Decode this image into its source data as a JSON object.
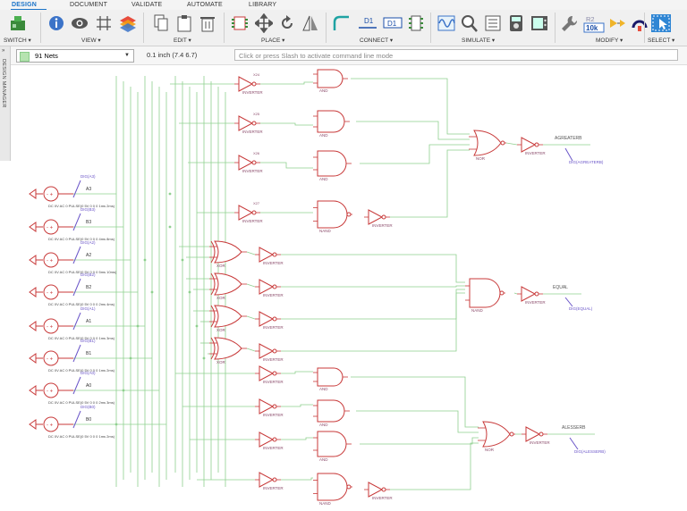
{
  "tabs": [
    {
      "label": "DESIGN",
      "active": true
    },
    {
      "label": "DOCUMENT",
      "active": false
    },
    {
      "label": "VALIDATE",
      "active": false
    },
    {
      "label": "AUTOMATE",
      "active": false
    },
    {
      "label": "LIBRARY",
      "active": false
    }
  ],
  "ribbon": {
    "switch_label": "SWITCH ▾",
    "view_label": "VIEW ▾",
    "edit_label": "EDIT ▾",
    "place_label": "PLACE ▾",
    "connect_label": "CONNECT ▾",
    "simulate_label": "SIMULATE ▾",
    "modify_label": "MODIFY ▾",
    "select_label": "SELECT ▾",
    "icon_d1a": "D1",
    "icon_d1b": "D1",
    "icon_r2": "R2",
    "icon_10k": "10k"
  },
  "cmdbar": {
    "net_select": "91 Nets",
    "grid_info": "0.1 inch (7.4 6.7)",
    "cmd_placeholder": "Click or press Slash to activate command line mode"
  },
  "sidebar": {
    "design_manager": "DESIGN MANAGER"
  },
  "schematic": {
    "wire_color": "#8fd08f",
    "part_color": "#c83a3a",
    "label_color": "#6a55c8",
    "sources": [
      {
        "name": "A3",
        "dig": "DIG(A3)",
        "param": "DC 0V AC 0 PULSE(0 5V 0 0 0 1ms 2ms)"
      },
      {
        "name": "B3",
        "dig": "DIG(B3)",
        "param": "DC 0V AC 0 PULSE(0 5V 0 0 0 4ms 8ms)"
      },
      {
        "name": "A2",
        "dig": "DIG(A2)",
        "param": "DC 0V AC 0 PULSE(0 5V 0 0 0 5ms 10ms)"
      },
      {
        "name": "B2",
        "dig": "DIG(B2)",
        "param": "DC 0V AC 0 PULSE(0 5V 0 0 0 2ms 4ms)"
      },
      {
        "name": "A1",
        "dig": "DIG(A1)",
        "param": "DC 0V AC 0 PULSE(0 5V 0 0 0 1ms 3ms)"
      },
      {
        "name": "B1",
        "dig": "DIG(B1)",
        "param": "DC 0V AC 0 PULSE(0 5V 0 0 0 1ms 2ms)"
      },
      {
        "name": "A0",
        "dig": "DIG(A0)",
        "param": "DC 0V AC 0 PULSE(0 5V 0 0 0 2ms 3ms)"
      },
      {
        "name": "B0",
        "dig": "DIG(B0)",
        "param": "DC 0V AC 0 PULSE(0 5V 0 0 0 1ms 2ms)"
      }
    ],
    "inverter_label": "INVERTER",
    "and_label": "AND",
    "nand_label": "NAND",
    "xor_label": "XOR",
    "nor_label": "NOR",
    "outputs": [
      {
        "net": "AGREATERB",
        "dig": "DIG(AGREATERB)"
      },
      {
        "net": "EQUAL",
        "dig": "DIG(EQUAL)"
      },
      {
        "net": "ALESSERB",
        "dig": "DIG(ALESSERB)"
      }
    ]
  }
}
